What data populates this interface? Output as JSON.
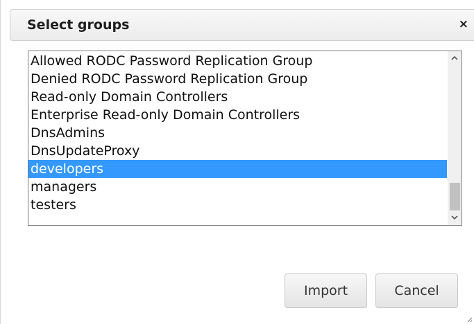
{
  "dialog": {
    "title": "Select groups",
    "close_glyph": "×"
  },
  "list": {
    "items": [
      "Allowed RODC Password Replication Group",
      "Denied RODC Password Replication Group",
      "Read-only Domain Controllers",
      "Enterprise Read-only Domain Controllers",
      "DnsAdmins",
      "DnsUpdateProxy",
      "developers",
      "managers",
      "testers"
    ],
    "selected": "developers"
  },
  "buttons": {
    "import": "Import",
    "cancel": "Cancel"
  },
  "colors": {
    "selection": "#3399ff"
  },
  "icons": {
    "close": "close-icon",
    "scroll_up": "chevron-up-icon",
    "scroll_down": "chevron-down-icon",
    "resize": "resize-grip-icon"
  }
}
